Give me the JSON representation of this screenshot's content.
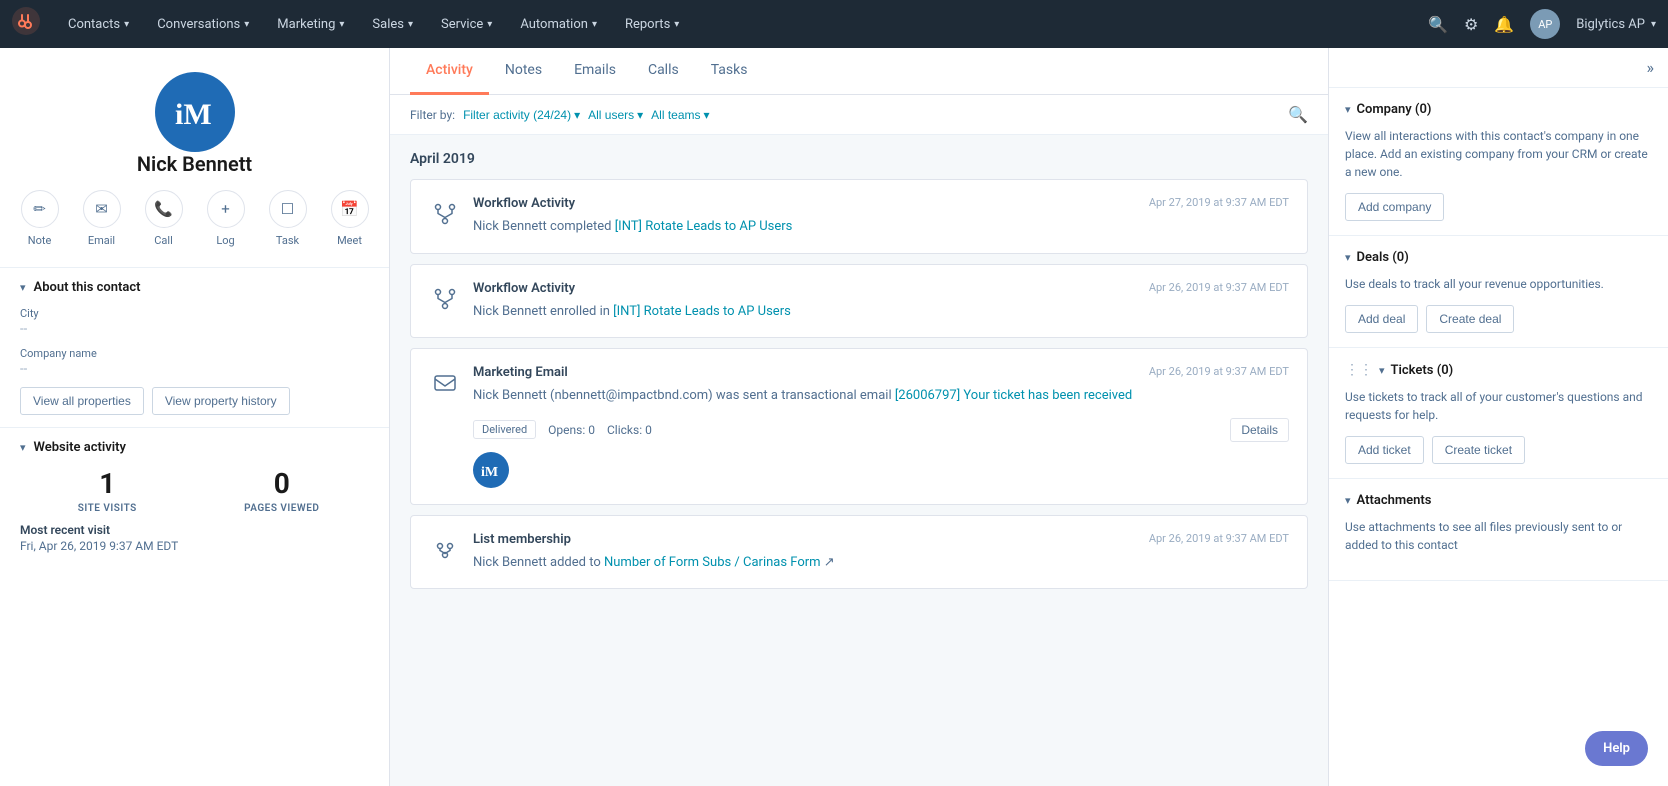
{
  "nav": {
    "logo": "H",
    "items": [
      {
        "label": "Contacts",
        "id": "contacts"
      },
      {
        "label": "Conversations",
        "id": "conversations"
      },
      {
        "label": "Marketing",
        "id": "marketing"
      },
      {
        "label": "Sales",
        "id": "sales"
      },
      {
        "label": "Service",
        "id": "service"
      },
      {
        "label": "Automation",
        "id": "automation"
      },
      {
        "label": "Reports",
        "id": "reports"
      }
    ],
    "user": "Biglytics AP"
  },
  "contact": {
    "name": "Nick Bennett",
    "initials": "iM",
    "actions": [
      {
        "id": "note",
        "label": "Note",
        "icon": "✏"
      },
      {
        "id": "email",
        "label": "Email",
        "icon": "✉"
      },
      {
        "id": "call",
        "label": "Call",
        "icon": "📞"
      },
      {
        "id": "log",
        "label": "Log",
        "icon": "+"
      },
      {
        "id": "task",
        "label": "Task",
        "icon": "⬜"
      },
      {
        "id": "meet",
        "label": "Meet",
        "icon": "📅"
      }
    ]
  },
  "about": {
    "section_title": "About this contact",
    "fields": [
      {
        "label": "City",
        "value": "--"
      },
      {
        "label": "Company name",
        "value": "--"
      }
    ],
    "btn_all_properties": "View all properties",
    "btn_property_history": "View property history"
  },
  "website_activity": {
    "section_title": "Website activity",
    "site_visits": "1",
    "site_visits_label": "SITE VISITS",
    "pages_viewed": "0",
    "pages_viewed_label": "PAGES VIEWED",
    "most_recent_label": "Most recent visit",
    "most_recent_date": "Fri, Apr 26, 2019 9:37 AM EDT"
  },
  "tabs": [
    {
      "id": "activity",
      "label": "Activity",
      "active": true
    },
    {
      "id": "notes",
      "label": "Notes",
      "active": false
    },
    {
      "id": "emails",
      "label": "Emails",
      "active": false
    },
    {
      "id": "calls",
      "label": "Calls",
      "active": false
    },
    {
      "id": "tasks",
      "label": "Tasks",
      "active": false
    }
  ],
  "filter_bar": {
    "label": "Filter by:",
    "filter_activity": "Filter activity (24/24)",
    "all_users": "All users",
    "all_teams": "All teams"
  },
  "timeline": {
    "month_header": "April 2019",
    "items": [
      {
        "id": "workflow-1",
        "type": "workflow",
        "title": "Workflow Activity",
        "date": "Apr 27, 2019 at 9:37 AM EDT",
        "desc_prefix": "Nick Bennett completed ",
        "desc_link": "[INT] Rotate Leads to AP Users",
        "desc_suffix": ""
      },
      {
        "id": "workflow-2",
        "type": "workflow",
        "title": "Workflow Activity",
        "date": "Apr 26, 2019 at 9:37 AM EDT",
        "desc_prefix": "Nick Bennett enrolled in ",
        "desc_link": "[INT] Rotate Leads to AP Users",
        "desc_suffix": ""
      },
      {
        "id": "marketing-email",
        "type": "email",
        "title": "Marketing Email",
        "date": "Apr 26, 2019 at 9:37 AM EDT",
        "desc_prefix": "Nick Bennett (nbennett@impactbnd.com) was sent a transactional email ",
        "desc_link": "[26006797] Your ticket has been received",
        "desc_suffix": "",
        "status": "Delivered",
        "opens": "0",
        "clicks": "0",
        "opens_label": "Opens:",
        "clicks_label": "Clicks:",
        "details_btn": "Details"
      },
      {
        "id": "list-membership",
        "type": "list",
        "title": "List membership",
        "date": "Apr 26, 2019 at 9:37 AM EDT",
        "desc_prefix": "Nick Bennett added to ",
        "desc_link": "Number of Form Subs / Carinas Form",
        "desc_suffix": " ↗"
      }
    ]
  },
  "right_panel": {
    "company": {
      "title": "Company (0)",
      "desc": "View all interactions with this contact's company in one place. Add an existing company from your CRM or create a new one.",
      "btn_add": "Add company",
      "id": "company-section"
    },
    "deals": {
      "title": "Deals (0)",
      "desc": "Use deals to track all your revenue opportunities.",
      "btn_add": "Add deal",
      "btn_create": "Create deal",
      "id": "deals-section"
    },
    "tickets": {
      "title": "Tickets (0)",
      "desc": "Use tickets to track all of your customer's questions and requests for help.",
      "btn_add": "Add ticket",
      "btn_create": "Create ticket",
      "id": "tickets-section"
    },
    "attachments": {
      "title": "Attachments",
      "desc": "Use attachments to see all files previously sent to or added to this contact",
      "id": "attachments-section"
    }
  },
  "help": {
    "label": "Help"
  },
  "colors": {
    "accent": "#ff7a59",
    "link": "#0091ae",
    "nav_bg": "#1e2a36"
  }
}
